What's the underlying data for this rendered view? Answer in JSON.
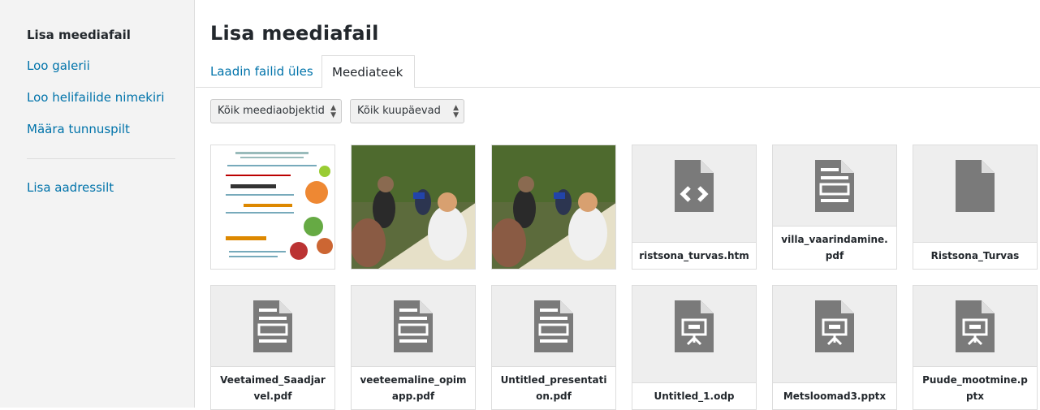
{
  "sidebar": {
    "items": [
      {
        "label": "Lisa meediafail"
      },
      {
        "label": "Loo galerii"
      },
      {
        "label": "Loo helifailide nimekiri"
      },
      {
        "label": "Määra tunnuspilt"
      },
      {
        "label": "Lisa aadressilt"
      }
    ]
  },
  "header": {
    "title": "Lisa meediafail"
  },
  "tabs": [
    {
      "label": "Laadin failid üles"
    },
    {
      "label": "Meediateek"
    }
  ],
  "filters": {
    "type_selected": "Kõik meediaobjektid",
    "date_selected": "Kõik kuupäevad"
  },
  "media": [
    {
      "kind": "image"
    },
    {
      "kind": "photo"
    },
    {
      "kind": "photo"
    },
    {
      "kind": "file",
      "icon": "code-file-icon",
      "filename": "ristsona_turvas.htm"
    },
    {
      "kind": "file",
      "icon": "document-file-icon",
      "filename": "villa_vaarindamine.pdf"
    },
    {
      "kind": "file",
      "icon": "generic-file-icon",
      "filename": "Ristsona_Turvas"
    },
    {
      "kind": "file",
      "icon": "document-file-icon",
      "filename": "Veetaimed_Saadjarvel.pdf"
    },
    {
      "kind": "file",
      "icon": "document-file-icon",
      "filename": "veeteemaline_opimapp.pdf"
    },
    {
      "kind": "file",
      "icon": "document-file-icon",
      "filename": "Untitled_presentation.pdf"
    },
    {
      "kind": "file",
      "icon": "presentation-file-icon",
      "filename": "Untitled_1.odp"
    },
    {
      "kind": "file",
      "icon": "presentation-file-icon",
      "filename": "Metsloomad3.pptx"
    },
    {
      "kind": "file",
      "icon": "presentation-file-icon",
      "filename": "Puude_mootmine.pptx"
    }
  ],
  "colors": {
    "link": "#0073aa",
    "text": "#23282d",
    "icon": "#7a7a7a"
  }
}
